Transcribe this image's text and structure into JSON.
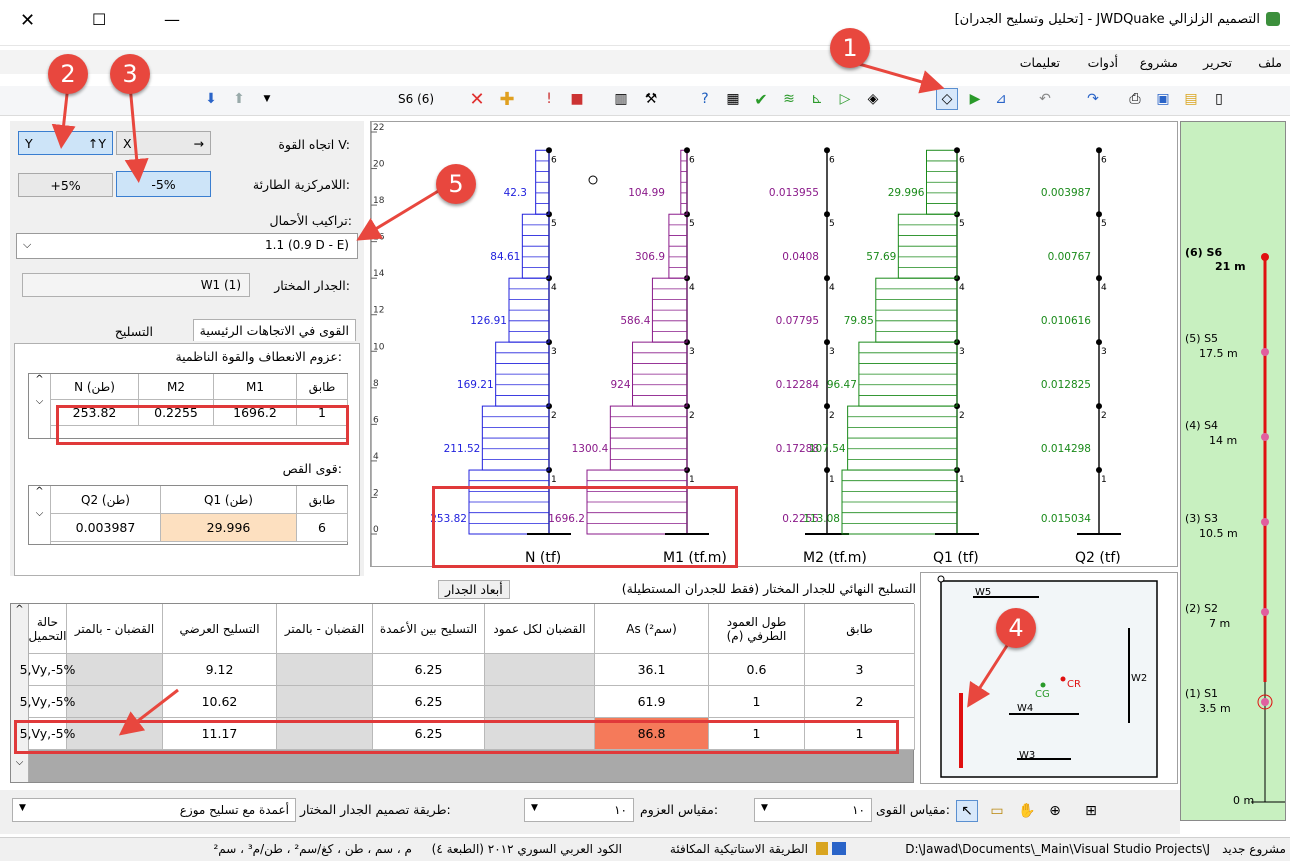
{
  "window": {
    "title": "التصميم الزلزالي JWDQuake - [تحليل وتسليح الجدران]",
    "close": "✕",
    "maximize": "☐",
    "minimize": "—"
  },
  "menu": [
    "ملف",
    "تحرير",
    "مشروع",
    "أدوات",
    "تعليمات"
  ],
  "toolbar": {
    "story_label": "S6 (6)"
  },
  "badges": [
    "1",
    "2",
    "3",
    "4",
    "5"
  ],
  "force_dir": {
    "label": "اتجاه القوة V:",
    "y_btn": "Y",
    "x_btn": "X",
    "y_axis": "Y"
  },
  "eccentricity": {
    "label": "اللامركزية الطارئة:",
    "plus": "+5%",
    "minus": "-5%"
  },
  "load_combo": {
    "label": "تراكيب الأحمال:",
    "value": "1.1 (0.9 D - E)"
  },
  "selected_wall": {
    "label": "الجدار المختار:",
    "value": "W1 (1)"
  },
  "tabs": {
    "forces": "القوى في الاتجاهات الرئيسية",
    "reinforcement": "التسليح"
  },
  "moments": {
    "title": "عزوم الانعطاف والقوة الناظمية:",
    "headers": [
      "طابق",
      "M1",
      "M2",
      "N (طن)"
    ],
    "row": [
      "1",
      "1696.2",
      "0.2255",
      "253.82"
    ]
  },
  "shear": {
    "title": "قوى القص:",
    "headers": [
      "طابق",
      "Q1 (طن)",
      "Q2 (طن)"
    ],
    "row": [
      "6",
      "29.996",
      "0.003987"
    ]
  },
  "chart_data": {
    "type": "bar",
    "y_ticks": [
      "0",
      "2",
      "4",
      "6",
      "8",
      "10",
      "12",
      "14",
      "16",
      "18",
      "20",
      "22"
    ],
    "ylim": [
      0,
      22
    ],
    "story_marks": [
      "1",
      "2",
      "3",
      "4",
      "5",
      "6"
    ],
    "panels": [
      {
        "name": "N (tf)",
        "color": "#2222dd",
        "labels": [
          "253.82",
          "211.52",
          "169.21",
          "126.91",
          "84.61",
          "42.3"
        ],
        "values": [
          253.82,
          211.52,
          169.21,
          126.91,
          84.61,
          42.3
        ]
      },
      {
        "name": "M1 (tf.m)",
        "color": "#8a1a8a",
        "labels": [
          "1696.2",
          "1300.4",
          "924",
          "586.4",
          "306.9",
          "104.99"
        ],
        "values": [
          1696.2,
          1300.4,
          924,
          586.4,
          306.9,
          104.99
        ]
      },
      {
        "name": "M2 (tf.m)",
        "color": "#8a1a8a",
        "labels": [
          "0.2255",
          "0.17288",
          "0.12284",
          "0.07795",
          "0.0408",
          "0.013955"
        ],
        "values": [
          0.2255,
          0.17288,
          0.12284,
          0.07795,
          0.0408,
          0.013955
        ]
      },
      {
        "name": "Q1 (tf)",
        "color": "#1a8a1a",
        "labels": [
          "113.08",
          "107.54",
          "96.47",
          "79.85",
          "57.69",
          "29.996"
        ],
        "values": [
          113.08,
          107.54,
          96.47,
          79.85,
          57.69,
          29.996
        ]
      },
      {
        "name": "Q2 (tf)",
        "color": "#1a8a1a",
        "labels": [
          "0.015034",
          "0.014298",
          "0.012825",
          "0.010616",
          "0.00767",
          "0.003987"
        ],
        "values": [
          0.015034,
          0.014298,
          0.012825,
          0.010616,
          0.00767,
          0.003987
        ]
      }
    ]
  },
  "final_reinf": {
    "tab1": "التسليح النهائي للجدار المختار (فقط للجدران المستطيلة)",
    "tab2": "أبعاد الجدار"
  },
  "reinf_table": {
    "headers": [
      "طابق",
      "طول العمود الطرفي (م)",
      "As (سم²)",
      "القضبان لكل عمود",
      "التسليح بين الأعمدة",
      "القضبان - بالمتر",
      "التسليح العرضي",
      "القضبان - بالمتر",
      "حالة التحميل"
    ],
    "rows": [
      [
        "3",
        "0.6",
        "36.1",
        "",
        "6.25",
        "",
        "9.12",
        "",
        "5,Vy,-5%"
      ],
      [
        "2",
        "1",
        "61.9",
        "",
        "6.25",
        "",
        "10.62",
        "",
        "5,Vy,-5%"
      ],
      [
        "1",
        "1",
        "86.8",
        "",
        "6.25",
        "",
        "11.17",
        "",
        "5,Vy,-5%"
      ]
    ]
  },
  "plan": {
    "walls": [
      "W5",
      "W2",
      "W4",
      "W3"
    ],
    "cg": "CG",
    "cr": "CR"
  },
  "stories": [
    {
      "name": "(6) S6",
      "h": "21 m"
    },
    {
      "name": "(5) S5",
      "h": "17.5 m"
    },
    {
      "name": "(4) S4",
      "h": "14 m"
    },
    {
      "name": "(3) S3",
      "h": "10.5 m"
    },
    {
      "name": "(2) S2",
      "h": "7 m"
    },
    {
      "name": "(1) S1",
      "h": "3.5 m"
    }
  ],
  "ground": "0 m",
  "bottom": {
    "design_method_label": "طريقة تصميم الجدار المختار:",
    "design_method_value": "أعمدة مع تسليح موزع",
    "moment_scale_label": "مقياس العزوم:",
    "moment_scale_value": "١٠",
    "force_scale_label": "مقياس القوى:",
    "force_scale_value": "١٠"
  },
  "status": {
    "project": "مشروع جديد",
    "path": "D:\\Jawad\\Documents\\_Main\\Visual Studio Projects\\J",
    "method": "الطريقة الاستاتيكية المكافئة",
    "code": "الكود العربي السوري ٢٠١٢ (الطبعة ٤)",
    "units": "م ، سم ، طن ، كغ/سم² ، طن/م³ ، سم²"
  }
}
